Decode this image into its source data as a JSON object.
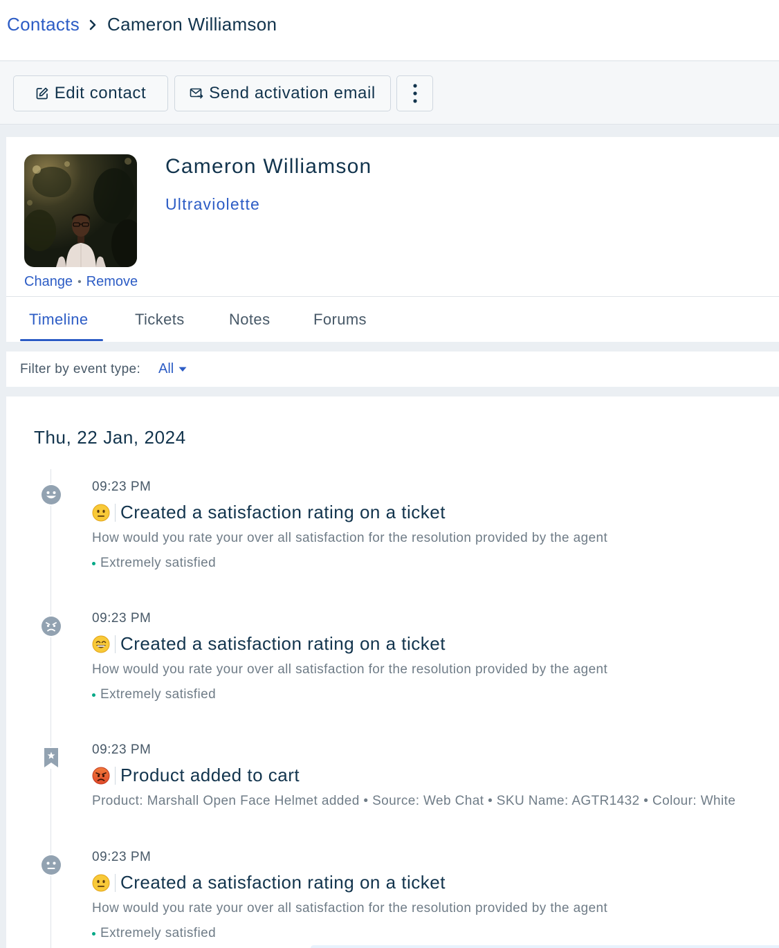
{
  "breadcrumb": {
    "root": "Contacts",
    "current": "Cameron Williamson"
  },
  "toolbar": {
    "edit_label": "Edit contact",
    "send_label": "Send activation email"
  },
  "profile": {
    "name": "Cameron Williamson",
    "company": "Ultraviolette",
    "change_label": "Change",
    "separator": "•",
    "remove_label": "Remove"
  },
  "tabs": [
    {
      "label": "Timeline",
      "active": true
    },
    {
      "label": "Tickets",
      "active": false
    },
    {
      "label": "Notes",
      "active": false
    },
    {
      "label": "Forums",
      "active": false
    }
  ],
  "filter": {
    "label": "Filter by event type:",
    "value": "All"
  },
  "timeline": {
    "date": "Thu, 22 Jan, 2024",
    "events": [
      {
        "time": "09:23 PM",
        "icon": "smile-icon",
        "emoji": "neutral-face-emoji",
        "title": "Created a satisfaction rating on a ticket",
        "description": "How would you rate your over all satisfaction for the resolution provided by the agent",
        "status": "Extremely satisfied"
      },
      {
        "time": "09:23 PM",
        "icon": "angry-face-icon",
        "emoji": "grinning-face-emoji",
        "title": "Created a satisfaction rating on a ticket",
        "description": "How would you rate your over all satisfaction for the resolution provided by the agent",
        "status": "Extremely satisfied"
      },
      {
        "time": "09:23 PM",
        "icon": "bookmark-star-icon",
        "emoji": "angry-face-emoji",
        "title": "Product added to cart",
        "description": "Product: Marshall Open Face Helmet added • Source: Web Chat • SKU Name: AGTR1432 • Colour: White",
        "status": ""
      },
      {
        "time": "09:23 PM",
        "icon": "neutral-face-icon",
        "emoji": "neutral-face-emoji",
        "title": "Created a satisfaction rating on a ticket",
        "description": "How would you rate your over all satisfaction for the resolution provided by the agent",
        "status": "Extremely satisfied"
      }
    ]
  },
  "colors": {
    "primary_blue": "#2c5cc5",
    "text_dark": "#12344d",
    "text_muted": "#6f7c87",
    "status_green": "#00a886",
    "icon_grey": "#92a2b1"
  }
}
